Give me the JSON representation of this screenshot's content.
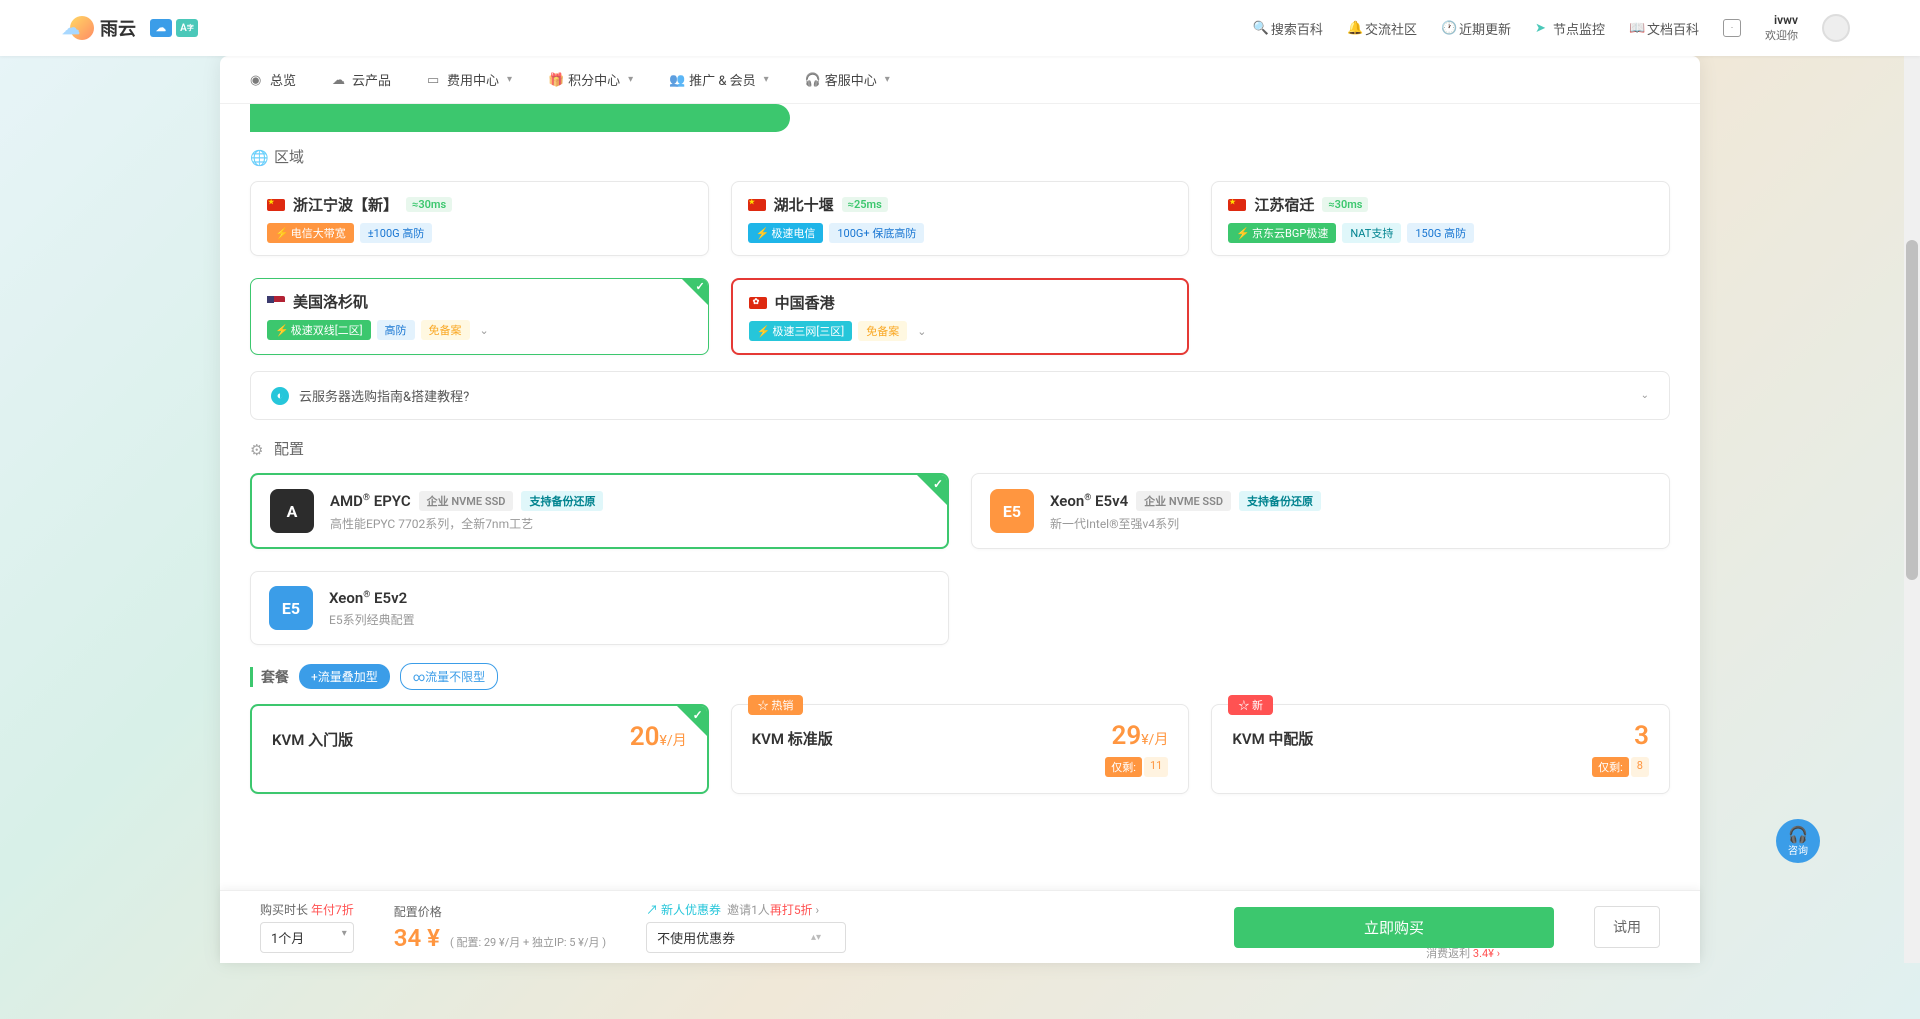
{
  "brand": "雨云",
  "top": {
    "search": "搜索百科",
    "community": "交流社区",
    "updates": "近期更新",
    "monitor": "节点监控",
    "docs": "文档百科",
    "user": "ivwv",
    "welcome": "欢迎你"
  },
  "nav": {
    "overview": "总览",
    "products": "云产品",
    "billing": "费用中心",
    "points": "积分中心",
    "promo": "推广 & 会员",
    "support": "客服中心"
  },
  "sections": {
    "region": "区域",
    "config": "配置",
    "plan": "套餐"
  },
  "regions": [
    {
      "name": "浙江宁波【新】",
      "flag": "cn",
      "ms": "≈30ms",
      "tags": [
        {
          "t": "电信大带宽",
          "c": "orange",
          "bolt": true
        },
        {
          "t": "±100G 高防",
          "c": "blue-o"
        }
      ]
    },
    {
      "name": "湖北十堰",
      "flag": "cn",
      "ms": "≈25ms",
      "tags": [
        {
          "t": "极速电信",
          "c": "blue",
          "bolt": true
        },
        {
          "t": "100G+ 保底高防",
          "c": "blue-o"
        }
      ]
    },
    {
      "name": "江苏宿迁",
      "flag": "cn",
      "ms": "≈30ms",
      "tags": [
        {
          "t": "京东云BGP极速",
          "c": "green",
          "bolt": true
        },
        {
          "t": "NAT支持",
          "c": "cyan"
        },
        {
          "t": "150G 高防",
          "c": "blue-o"
        }
      ]
    },
    {
      "name": "美国洛杉矶",
      "flag": "us",
      "ms": "",
      "selected": true,
      "hl": true,
      "tags": [
        {
          "t": "极速双线[二区]",
          "c": "green",
          "bolt": true
        },
        {
          "t": "高防",
          "c": "blue-o"
        },
        {
          "t": "免备案",
          "c": "yellow"
        }
      ],
      "more": true
    },
    {
      "name": "中国香港",
      "flag": "hk",
      "ms": "",
      "hl": true,
      "tags": [
        {
          "t": "极速三网[三区]",
          "c": "teal",
          "bolt": true
        },
        {
          "t": "免备案",
          "c": "yellow"
        }
      ],
      "more": true
    }
  ],
  "guide": "云服务器选购指南&搭建教程?",
  "configs": [
    {
      "icon": "A",
      "ic": "dark",
      "title": "AMD® EPYC",
      "desc": "高性能EPYC 7702系列，全新7nm工艺",
      "badges": [
        {
          "t": "企业 NVME SSD",
          "c": "gray"
        },
        {
          "t": "支持备份还原",
          "c": "cyan"
        }
      ],
      "selected": true
    },
    {
      "icon": "E5",
      "ic": "orange",
      "title": "Xeon® E5v4",
      "desc": "新一代Intel®至强v4系列",
      "badges": [
        {
          "t": "企业 NVME SSD",
          "c": "gray"
        },
        {
          "t": "支持备份还原",
          "c": "cyan"
        }
      ]
    },
    {
      "icon": "E5",
      "ic": "blue",
      "title": "Xeon® E5v2",
      "desc": "E5系列经典配置",
      "badges": []
    }
  ],
  "planTabs": {
    "active": "+流量叠加型",
    "inactive": "∞流量不限型"
  },
  "plans": [
    {
      "name": "KVM 入门版",
      "price": "20",
      "unit": "¥/月",
      "badge": "",
      "selected": true
    },
    {
      "name": "KVM 标准版",
      "price": "29",
      "unit": "¥/月",
      "badge": "热销",
      "bc": "hot",
      "stock": "11"
    },
    {
      "name": "KVM 中配版",
      "price": "3",
      "unit": "",
      "badge": "新",
      "bc": "new",
      "stock": "8"
    }
  ],
  "stockLabel": "仅剩:",
  "bottom": {
    "durationLabel": "购买时长",
    "durationTag": "年付7折",
    "durationVal": "1个月",
    "priceLabel": "配置价格",
    "price": "34 ¥",
    "detail": "( 配置: 29 ¥/月 + 独立IP: 5 ¥/月 )",
    "couponLink": "新人优惠券",
    "couponTip": "邀请1人再打5折",
    "couponTip2": "邀请1人",
    "couponVal": "不使用优惠券",
    "rebateLabel": "消费返利",
    "rebateVal": "3.4¥",
    "buy": "立即购买",
    "try": "试用"
  },
  "help": "咨询"
}
